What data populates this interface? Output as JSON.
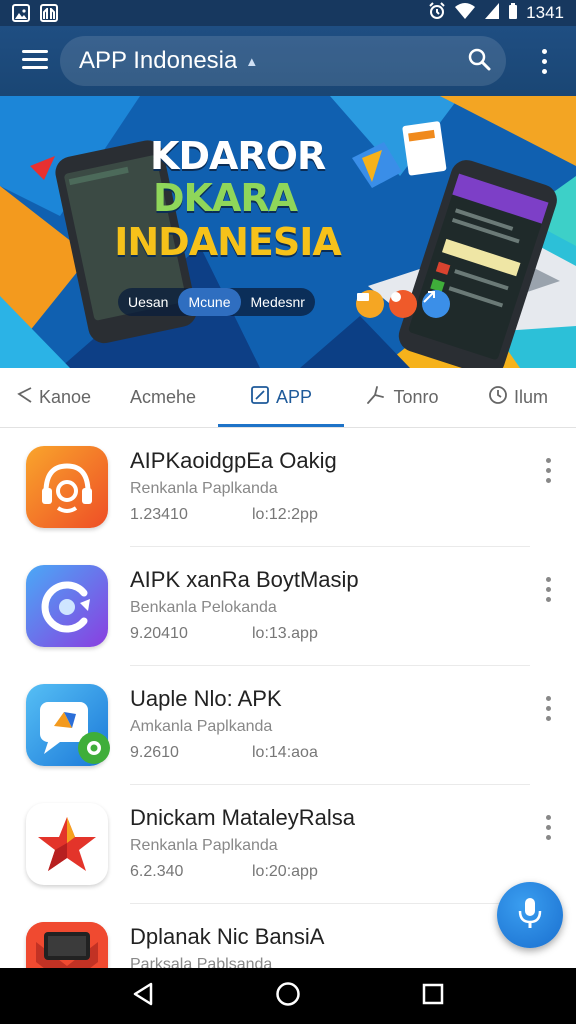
{
  "status_bar": {
    "time": "1341"
  },
  "app_bar": {
    "title": "APP Indonesia",
    "caret": "▲"
  },
  "banner": {
    "line1": "KDAROR",
    "line2": "DKARA",
    "line3": "INDANESIA",
    "pills": [
      "Uesan",
      "Mcune",
      "Medesnr"
    ]
  },
  "tabs": [
    {
      "label": "Kanoe",
      "icon": "plane-icon"
    },
    {
      "label": "Acmehe",
      "icon": ""
    },
    {
      "label": "APP",
      "icon": "app-icon",
      "active": true
    },
    {
      "label": "Tonro",
      "icon": "tools-icon"
    },
    {
      "label": "Ilum",
      "icon": "clock-icon"
    }
  ],
  "apps": [
    {
      "name": "AIPKaoidgpEa Oakig",
      "developer": "Renkanla Paplkanda",
      "size": "1.23410",
      "date": "lo:12:2pp",
      "icon": "headset-icon",
      "colors": [
        "#f7a12b",
        "#ef5a2a"
      ]
    },
    {
      "name": "AIPK xanRa BoytMasip",
      "developer": "Benkanla Pelokanda",
      "size": "9.20410",
      "date": "lo:13.app",
      "icon": "camera-c-icon",
      "colors": [
        "#48a6f5",
        "#8e3fe0"
      ]
    },
    {
      "name": "Uaple Nlo: APK",
      "developer": "Amkanla Paplkanda",
      "size": "9.2610",
      "date": "lo:14:aoa",
      "icon": "chat-icon",
      "colors": [
        "#4fb8f3",
        "#1a78d8"
      ]
    },
    {
      "name": "Dnickam MataleyRalsa",
      "developer": "Renkanla Paplkanda",
      "size": "6.2.340",
      "date": "lo:20:app",
      "icon": "star-icon",
      "colors": [
        "#ffffff",
        "#f2f2f2"
      ]
    },
    {
      "name": "Dplanak Nic BansiA",
      "developer": "Parksala Pablsanda",
      "size": "",
      "date": "",
      "icon": "gmail-icon",
      "colors": [
        "#222222",
        "#e5412f"
      ]
    }
  ],
  "colors": {
    "app_bar": "#1f4e82",
    "accent": "#1e73c8",
    "fab": "#1a6fcf"
  }
}
